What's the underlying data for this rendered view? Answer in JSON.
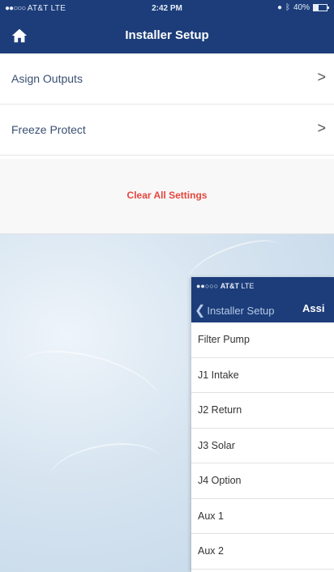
{
  "status_bar": {
    "carrier": "AT&T",
    "network": "LTE",
    "time": "2:42 PM",
    "battery": "40%"
  },
  "header": {
    "title": "Installer Setup",
    "home_icon": "home-icon"
  },
  "menu": {
    "items": [
      {
        "label": "Asign Outputs",
        "chevron": ">"
      },
      {
        "label": "Freeze Protect",
        "chevron": ">"
      }
    ],
    "clear_label": "Clear All Settings",
    "clear_color": "#e4463d"
  },
  "overlay": {
    "status_bar": {
      "carrier": "AT&T",
      "network": "LTE"
    },
    "back_label": "Installer Setup",
    "title": "Assi",
    "items": [
      "Filter Pump",
      "J1 Intake",
      "J2 Return",
      "J3 Solar",
      "J4 Option",
      "Aux 1",
      "Aux 2"
    ]
  },
  "colors": {
    "nav_blue": "#1c3d7a",
    "accent_red": "#e4463d"
  }
}
